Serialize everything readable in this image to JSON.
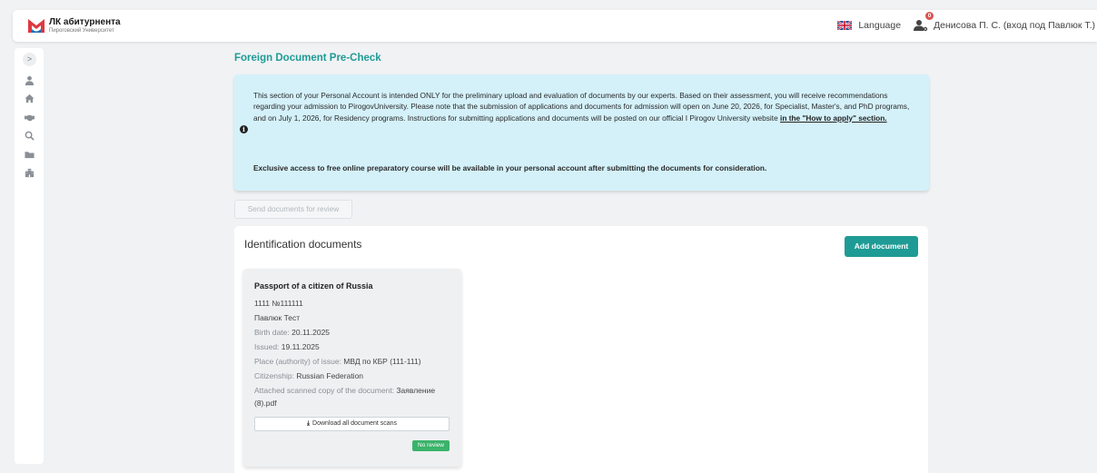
{
  "header": {
    "logo_title": "ЛК абитурнента",
    "logo_subtitle": "Пироговский Университет",
    "language_label": "Language",
    "notification_count": "0",
    "user_name": "Денисова П. С. (вход под Павлюк Т.)",
    "brand_color": "#1f9b95"
  },
  "sidebar": {
    "toggle_glyph": ">",
    "icons": [
      "user-icon",
      "home-icon",
      "handshake-icon",
      "search-icon",
      "folder-icon",
      "building-icon"
    ]
  },
  "main": {
    "title": "Foreign Document Pre-Check",
    "info_text_main": "This section of your Personal Account is intended ONLY for the preliminary upload and evaluation of documents by our experts. Based on their assessment, you will receive recommendations regarding your admission to PirogovUniversity. Please note that the submission of applications and documents for admission will open on June 20, 2026, for Specialist, Master's, and PhD programs, and on July 1, 2026, for Residency programs. Instructions for submitting applications and documents will be posted on our official I Pirogov University website ",
    "info_link": "in the \"How to apply\" section.",
    "info_text_bold": "Exclusive access to free online preparatory course will be available in your personal account after submitting the documents for consideration.",
    "send_button": "Send documents for review"
  },
  "panel": {
    "title": "Identification documents",
    "add_button": "Add document",
    "document": {
      "title": "Passport of a citizen of Russia",
      "number": "1111 №111111",
      "holder": "Павлюк Тест",
      "birth_label": "Birth date:",
      "birth_value": "20.11.2025",
      "issued_label": "Issued:",
      "issued_value": "19.11.2025",
      "place_label": "Place (authority) of issue:",
      "place_value": "МВД по КБР (111-111)",
      "citizenship_label": "Citizenship:",
      "citizenship_value": "Russian Federation",
      "attached_label": "Attached scanned copy of the document:",
      "attached_value_1": "Заявление",
      "attached_value_2": "(8).pdf",
      "download_button": "Download all document scans",
      "status_badge": "No review"
    }
  }
}
